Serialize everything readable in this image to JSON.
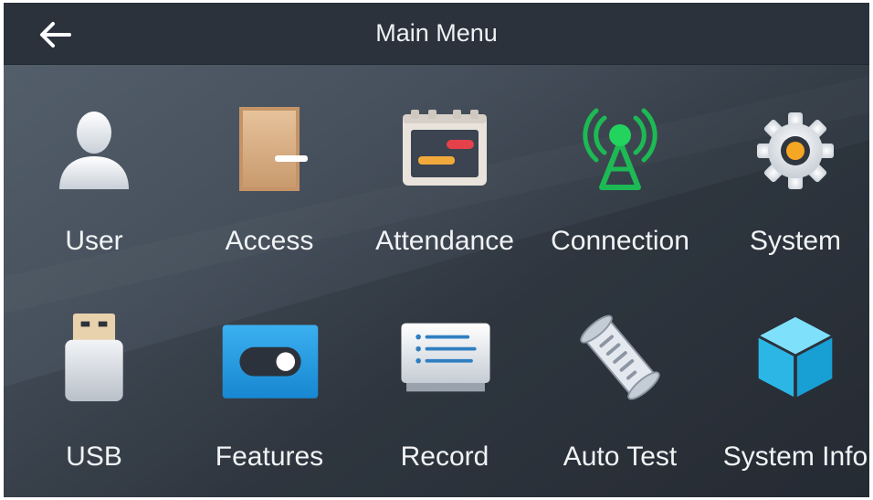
{
  "header": {
    "title": "Main Menu",
    "back_icon": "arrow-left-icon"
  },
  "menu": {
    "items": [
      {
        "label": "User",
        "icon": "user-icon"
      },
      {
        "label": "Access",
        "icon": "door-icon"
      },
      {
        "label": "Attendance",
        "icon": "attendance-card-icon"
      },
      {
        "label": "Connection",
        "icon": "signal-tower-icon"
      },
      {
        "label": "System",
        "icon": "gear-icon"
      },
      {
        "label": "USB",
        "icon": "usb-drive-icon"
      },
      {
        "label": "Features",
        "icon": "toggle-switch-icon"
      },
      {
        "label": "Record",
        "icon": "record-list-icon"
      },
      {
        "label": "Auto Test",
        "icon": "scroll-icon"
      },
      {
        "label": "System Info",
        "icon": "cube-icon"
      }
    ]
  },
  "colors": {
    "header_bg": "#2b323b",
    "body_bg": "#46505c",
    "text": "#f1f3f5",
    "signal_green": "#1db954",
    "gear_orange": "#f5a623",
    "door_tan": "#d8b28a",
    "features_blue": "#1e9be0",
    "cube_blue": "#3cc3ee"
  }
}
